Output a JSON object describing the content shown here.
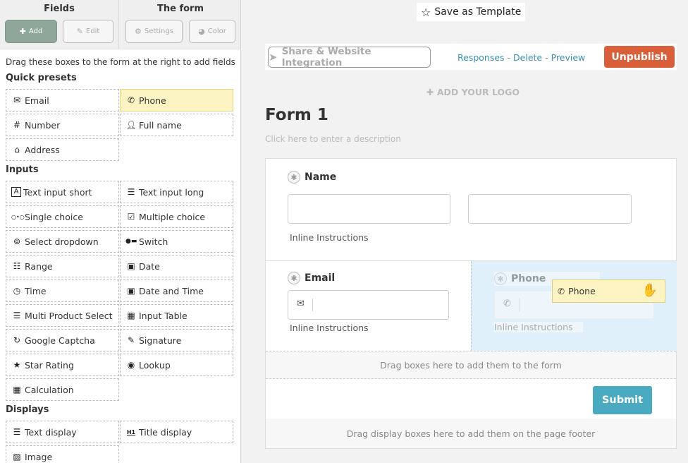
{
  "sidebar": {
    "head": {
      "fields_title": "Fields",
      "form_title": "The form",
      "add_label": "Add",
      "edit_label": "Edit",
      "settings_label": "Settings",
      "color_label": "Color"
    },
    "instructions": "Drag these boxes to the form at the right to add fields",
    "quick_presets": {
      "title": "Quick presets",
      "items": [
        {
          "label": "Email",
          "icon": "envelope-icon"
        },
        {
          "label": "Phone",
          "icon": "phone-icon",
          "highlighted": true
        },
        {
          "label": "Number",
          "icon": "hash-icon"
        },
        {
          "label": "Full name",
          "icon": "user-icon"
        },
        {
          "label": "Address",
          "icon": "home-icon"
        }
      ]
    },
    "inputs": {
      "title": "Inputs",
      "items": [
        {
          "label": "Text input short",
          "icon": "text-a-icon"
        },
        {
          "label": "Text input long",
          "icon": "text-lines-icon"
        },
        {
          "label": "Single choice",
          "icon": "radio-dots-icon"
        },
        {
          "label": "Multiple choice",
          "icon": "checkbox-icon"
        },
        {
          "label": "Select dropdown",
          "icon": "dropdown-circle-icon"
        },
        {
          "label": "Switch",
          "icon": "switch-icon"
        },
        {
          "label": "Range",
          "icon": "sliders-icon"
        },
        {
          "label": "Date",
          "icon": "calendar-plus-icon"
        },
        {
          "label": "Time",
          "icon": "clock-icon"
        },
        {
          "label": "Date and Time",
          "icon": "calendar-plus-icon"
        },
        {
          "label": "Multi Product Select",
          "icon": "list-icon"
        },
        {
          "label": "Input Table",
          "icon": "table-icon"
        },
        {
          "label": "Google Captcha",
          "icon": "refresh-icon"
        },
        {
          "label": "Signature",
          "icon": "edit-icon"
        },
        {
          "label": "Star Rating",
          "icon": "star-icon"
        },
        {
          "label": "Lookup",
          "icon": "eye-icon"
        },
        {
          "label": "Calculation",
          "icon": "calculator-icon"
        }
      ]
    },
    "displays": {
      "title": "Displays",
      "items": [
        {
          "label": "Text display",
          "icon": "text-align-icon"
        },
        {
          "label": "Title display",
          "icon": "h1-icon"
        },
        {
          "label": "Image",
          "icon": "image-icon"
        }
      ]
    }
  },
  "main": {
    "save_template": "Save as Template",
    "toolbar": {
      "share_label": "Share & Website Integration",
      "responses": "Responses",
      "delete": "Delete",
      "preview": "Preview",
      "separator": "-",
      "unpublish": "Unpublish"
    },
    "add_logo": "ADD YOUR LOGO",
    "form_title": "Form 1",
    "form_description_placeholder": "Click here to enter a description",
    "fields": {
      "name_label": "Name",
      "name_instructions": "Inline Instructions",
      "email_label": "Email",
      "email_instructions": "Inline Instructions",
      "phone_label": "Phone",
      "phone_instructions": "Inline Instructions"
    },
    "drop_fields_hint": "Drag boxes here to add them to the form",
    "submit_label": "Submit",
    "drop_footer_hint": "Drag display boxes here to add them on the page footer",
    "dragging_tile": "Phone"
  },
  "colors": {
    "accent_add": "#8fa79a",
    "unpublish": "#d95f3b",
    "submit": "#4aabc0",
    "highlight": "#fbf3c2",
    "drop_zone": "#e0f0fa",
    "link": "#3a8fb7"
  }
}
